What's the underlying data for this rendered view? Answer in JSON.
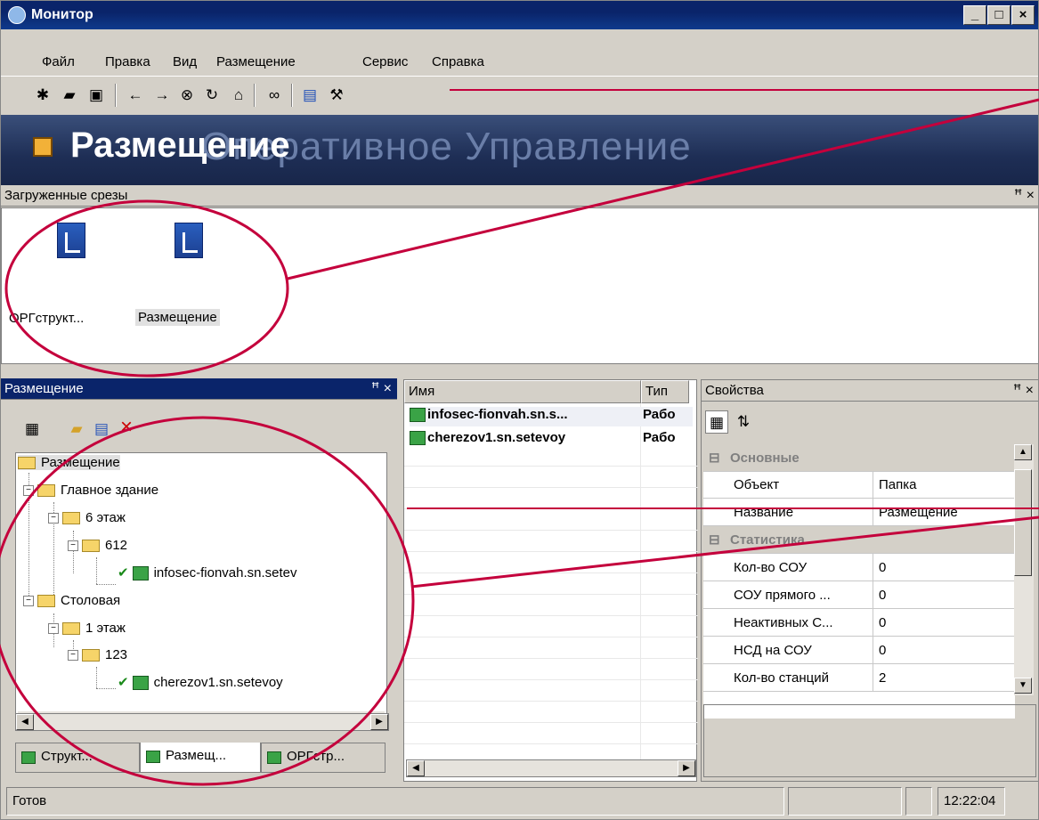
{
  "window": {
    "title": "Монитор",
    "min": "_",
    "max": "□",
    "close": "×"
  },
  "menu": [
    "Файл",
    "Правка",
    "Вид",
    "Размещение",
    "Сервис",
    "Справка"
  ],
  "banner": {
    "title": "Размещение",
    "ghost": "Оперативное Управление"
  },
  "slices_pane": {
    "title": "Загруженные срезы",
    "pin": "ꟸ ×",
    "items": [
      "ОРГструкт...",
      "Размещение"
    ]
  },
  "placement_pane": {
    "title": "Размещение",
    "pin": "ꟸ ×"
  },
  "tree": {
    "root": "Размещение",
    "building1": "Главное здание",
    "floor6": "6 этаж",
    "room612": "612",
    "station1": "infosec-fionvah.sn.setev",
    "building2": "Столовая",
    "floor1": "1 этаж",
    "room123": "123",
    "station2": "cherezov1.sn.setevoy"
  },
  "tabs": [
    "Структ...",
    "Размещ...",
    "ОРГстр..."
  ],
  "list": {
    "col_name": "Имя",
    "col_type": "Тип",
    "rows": [
      {
        "name": "infosec-fionvah.sn.s...",
        "type": "Рабо"
      },
      {
        "name": "cherezov1.sn.setevoy",
        "type": "Рабо"
      }
    ]
  },
  "props_pane": {
    "title": "Свойства",
    "pin": "ꟸ ×",
    "cat_main": "Основные",
    "cat_stats": "Статистика",
    "rows": [
      {
        "k": "Объект",
        "v": "Папка"
      },
      {
        "k": "Название",
        "v": "Размещение"
      }
    ],
    "stats": [
      {
        "k": "Кол-во СОУ",
        "v": "0"
      },
      {
        "k": "СОУ прямого ...",
        "v": "0"
      },
      {
        "k": "Неактивных С...",
        "v": "0"
      },
      {
        "k": "НСД на СОУ",
        "v": "0"
      },
      {
        "k": "Кол-во станций",
        "v": "2"
      }
    ]
  },
  "status": {
    "text": "Готов",
    "time": "12:22:04"
  },
  "colors": {
    "annotation": "#c4003c",
    "title_bg": "#0a246a"
  }
}
